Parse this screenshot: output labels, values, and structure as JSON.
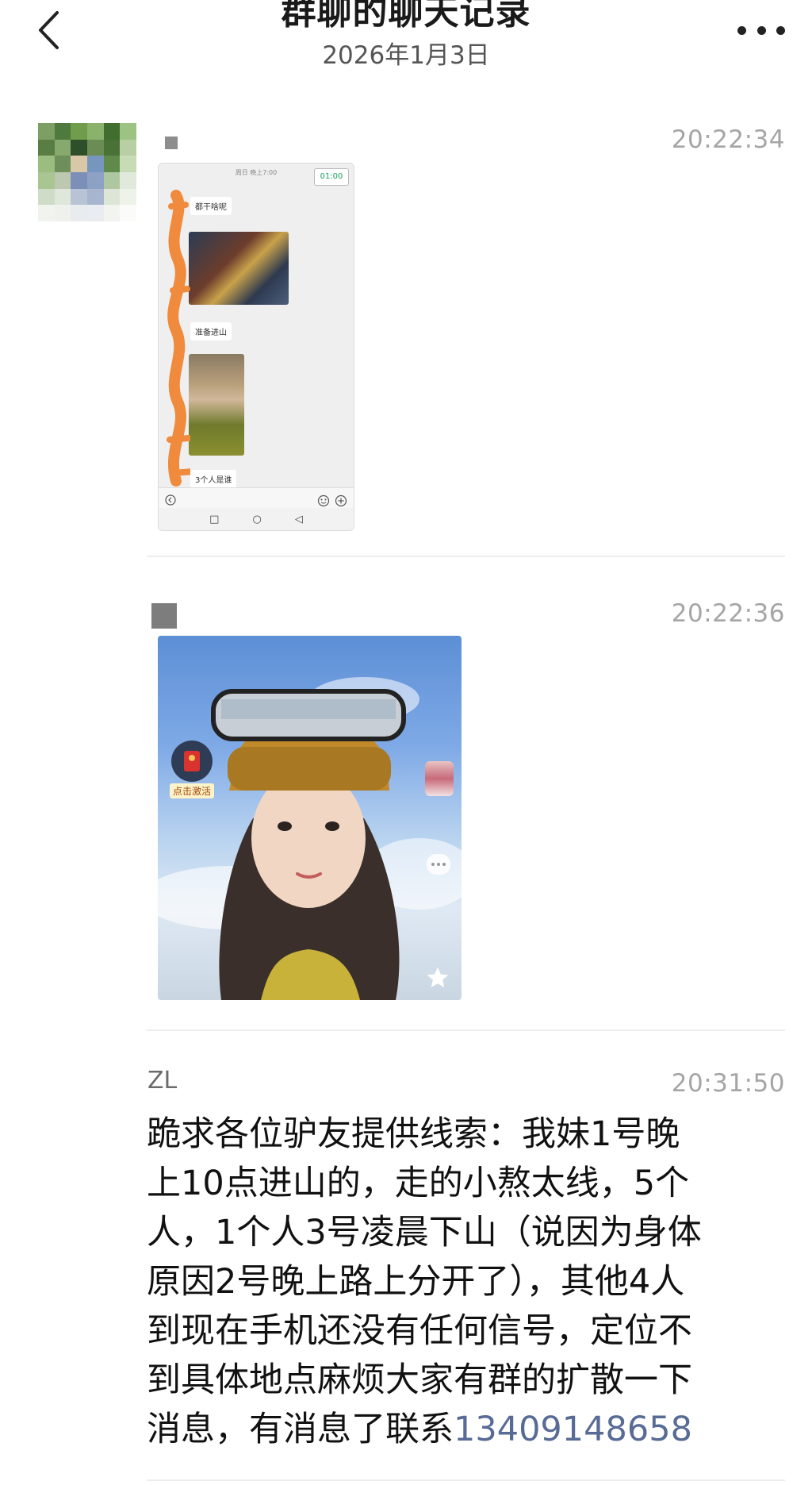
{
  "header": {
    "title": "群聊的聊天记录",
    "date": "2026年1月3日"
  },
  "messages": [
    {
      "timestamp": "20:22:34",
      "type": "image",
      "screenshot": {
        "status_text": "周日 晚上7:00",
        "timer": "01:00",
        "bubble_1": "都干啥呢",
        "bubble_2": "准备进山",
        "bubble_3": "3个人是谁"
      }
    },
    {
      "timestamp": "20:22:36",
      "type": "image",
      "badge_label": "点击激活"
    },
    {
      "sender": "ZL",
      "timestamp": "20:31:50",
      "type": "text",
      "lines": [
        "跪求各位驴友提供线索：我妹1号晚",
        "上10点进山的，走的小熬太线，5个",
        "人，1个人3号凌晨下山（说因为身体",
        "原因2号晚上路上分开了），其他4人",
        "到现在手机还没有任何信号，定位不",
        "到具体地点麻烦大家有群的扩散一下"
      ],
      "last_line_prefix": "消息，有消息了联系",
      "phone": "13409148658"
    }
  ],
  "colors": {
    "timestamp": "#a5a5a5",
    "link": "#576b95",
    "divider": "#ededed"
  }
}
